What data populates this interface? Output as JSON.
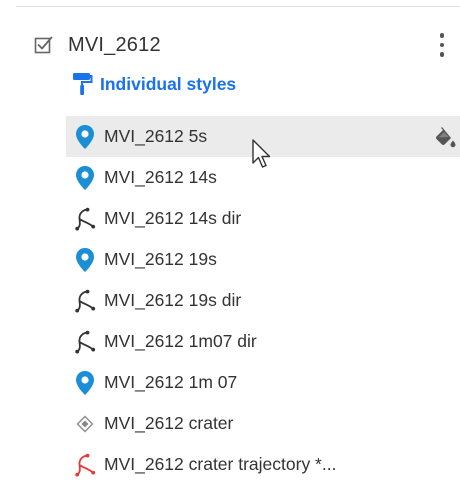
{
  "layer": {
    "title": "MVI_2612",
    "checked": true,
    "more_menu_icon": "more-vert-icon"
  },
  "styles": {
    "label": "Individual styles",
    "icon": "paint-roller-icon",
    "color": "#1a73e8"
  },
  "features": [
    {
      "label": "MVI_2612 5s",
      "icon": "map-pin-icon",
      "highlighted": true
    },
    {
      "label": "MVI_2612 14s",
      "icon": "map-pin-icon"
    },
    {
      "label": "MVI_2612 14s dir",
      "icon": "line-path-icon"
    },
    {
      "label": "MVI_2612 19s",
      "icon": "map-pin-icon"
    },
    {
      "label": "MVI_2612 19s dir",
      "icon": "line-path-icon"
    },
    {
      "label": "MVI_2612 1m07 dir",
      "icon": "line-path-icon"
    },
    {
      "label": "MVI_2612 1m 07",
      "icon": "map-pin-icon"
    },
    {
      "label": "MVI_2612 crater",
      "icon": "polygon-icon"
    },
    {
      "label": "MVI_2612 crater trajectory *...",
      "icon": "line-path-icon",
      "icon_color": "#e53935"
    }
  ],
  "colors": {
    "pin": "#1a8fd6",
    "line": "#333333",
    "polygon": "#8a8a8a",
    "highlight": "#ebebeb"
  }
}
